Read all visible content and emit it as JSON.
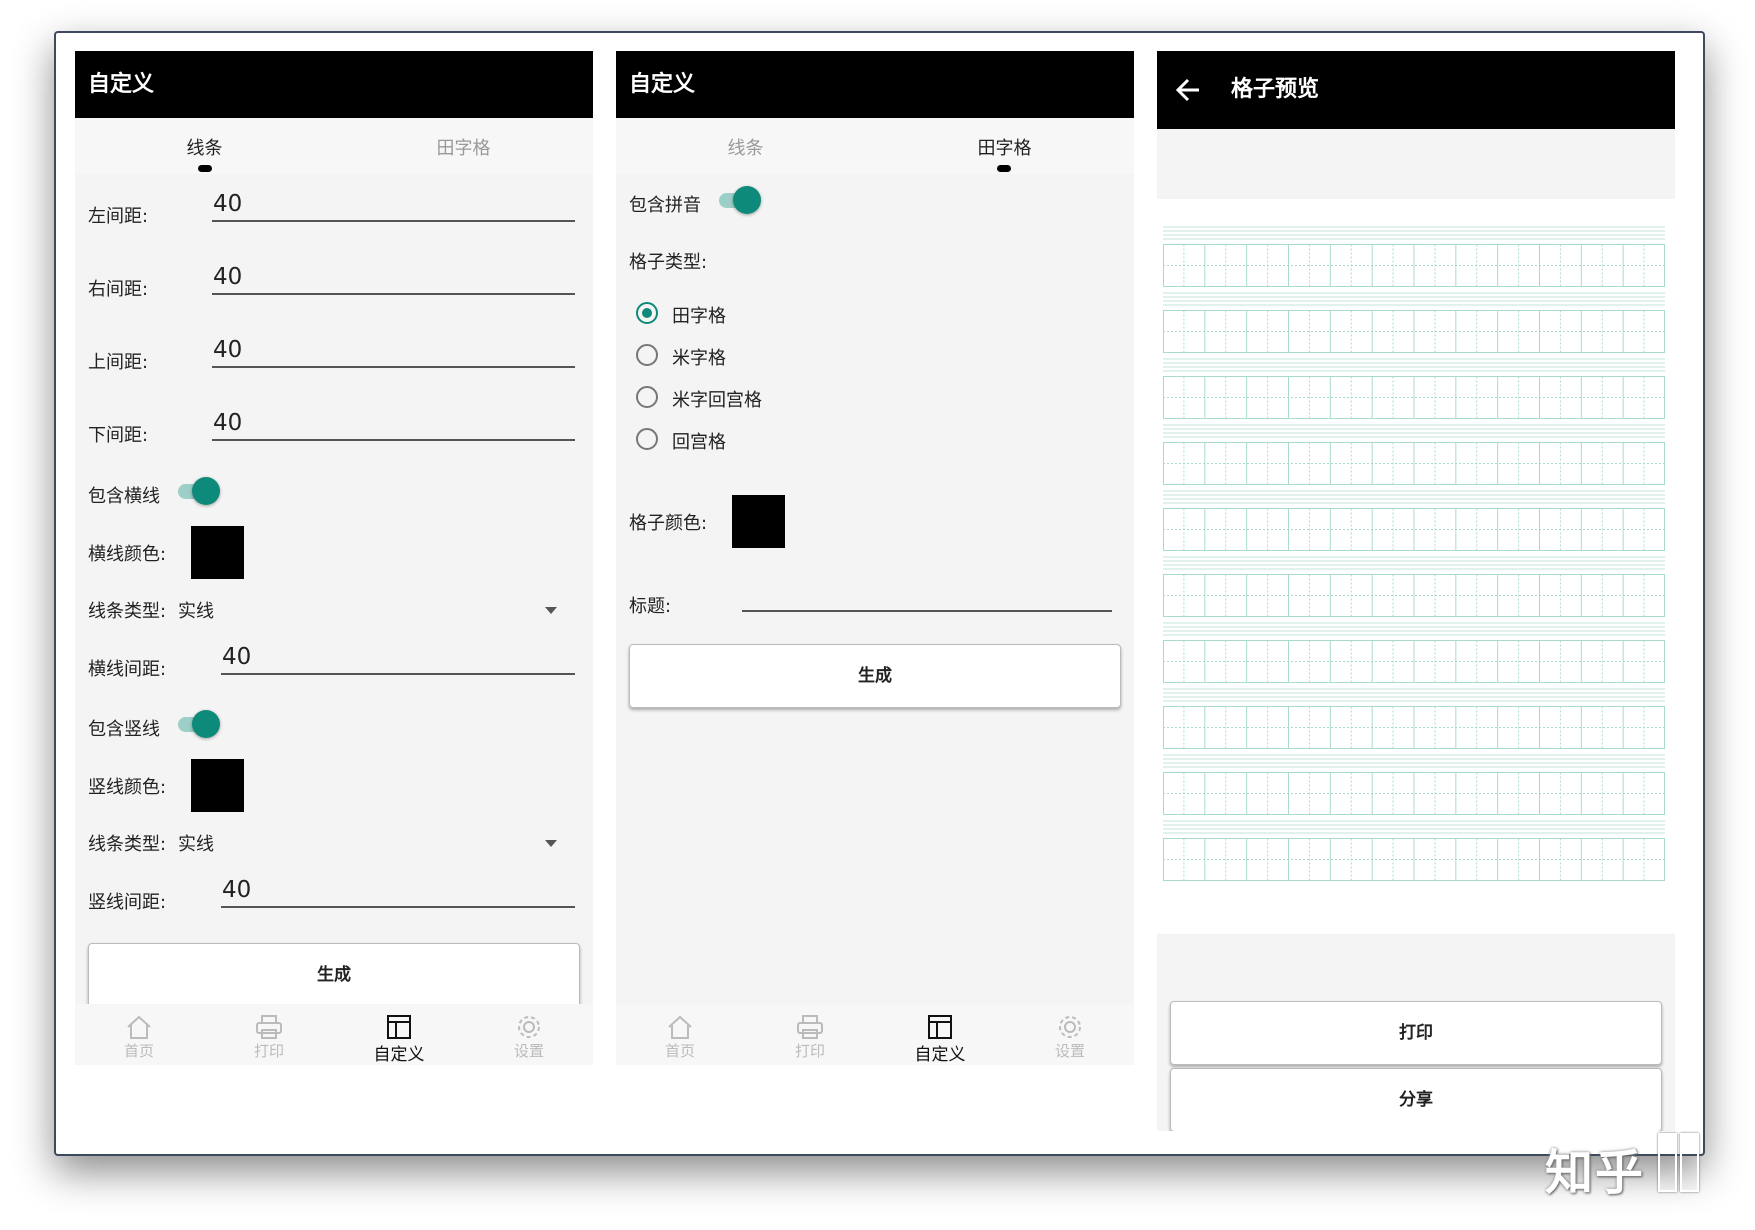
{
  "screens": {
    "lines": {
      "title": "自定义",
      "tabs": [
        "线条",
        "田字格"
      ],
      "left_margin": {
        "label": "左间距:",
        "value": "40"
      },
      "right_margin": {
        "label": "右间距:",
        "value": "40"
      },
      "top_margin": {
        "label": "上间距:",
        "value": "40"
      },
      "bottom_margin": {
        "label": "下间距:",
        "value": "40"
      },
      "include_horizontal": {
        "label": "包含横线",
        "on": true
      },
      "horizontal_color": {
        "label": "横线颜色:",
        "color": "#000000"
      },
      "horizontal_line_type": {
        "label": "线条类型:",
        "value": "实线"
      },
      "horizontal_spacing": {
        "label": "横线间距:",
        "value": "40"
      },
      "include_vertical": {
        "label": "包含竖线",
        "on": true
      },
      "vertical_color": {
        "label": "竖线颜色:",
        "color": "#000000"
      },
      "vertical_line_type": {
        "label": "线条类型:",
        "value": "实线"
      },
      "vertical_spacing": {
        "label": "竖线间距:",
        "value": "40"
      },
      "generate_label": "生成"
    },
    "tianzige": {
      "title": "自定义",
      "tabs": [
        "线条",
        "田字格"
      ],
      "include_pinyin": {
        "label": "包含拼音",
        "on": true
      },
      "grid_type_label": "格子类型:",
      "grid_types": [
        {
          "label": "田字格",
          "selected": true
        },
        {
          "label": "米字格",
          "selected": false
        },
        {
          "label": "米字回宫格",
          "selected": false
        },
        {
          "label": "回宫格",
          "selected": false
        }
      ],
      "grid_color": {
        "label": "格子颜色:",
        "color": "#000000"
      },
      "title_field": {
        "label": "标题:",
        "value": ""
      },
      "generate_label": "生成"
    },
    "preview": {
      "title": "格子预览",
      "grid_rows": 10,
      "grid_line_color": "#a8dcc6",
      "print_label": "打印",
      "share_label": "分享"
    }
  },
  "bottom_nav": [
    {
      "label": "首页",
      "icon": "home-icon",
      "active": false
    },
    {
      "label": "打印",
      "icon": "printer-icon",
      "active": false
    },
    {
      "label": "自定义",
      "icon": "layout-icon",
      "active": true
    },
    {
      "label": "设置",
      "icon": "gear-icon",
      "active": false
    }
  ],
  "colors": {
    "accent": "#0e8a7a",
    "appbar": "#000000",
    "background": "#f7f7f7"
  },
  "watermark": "知乎"
}
